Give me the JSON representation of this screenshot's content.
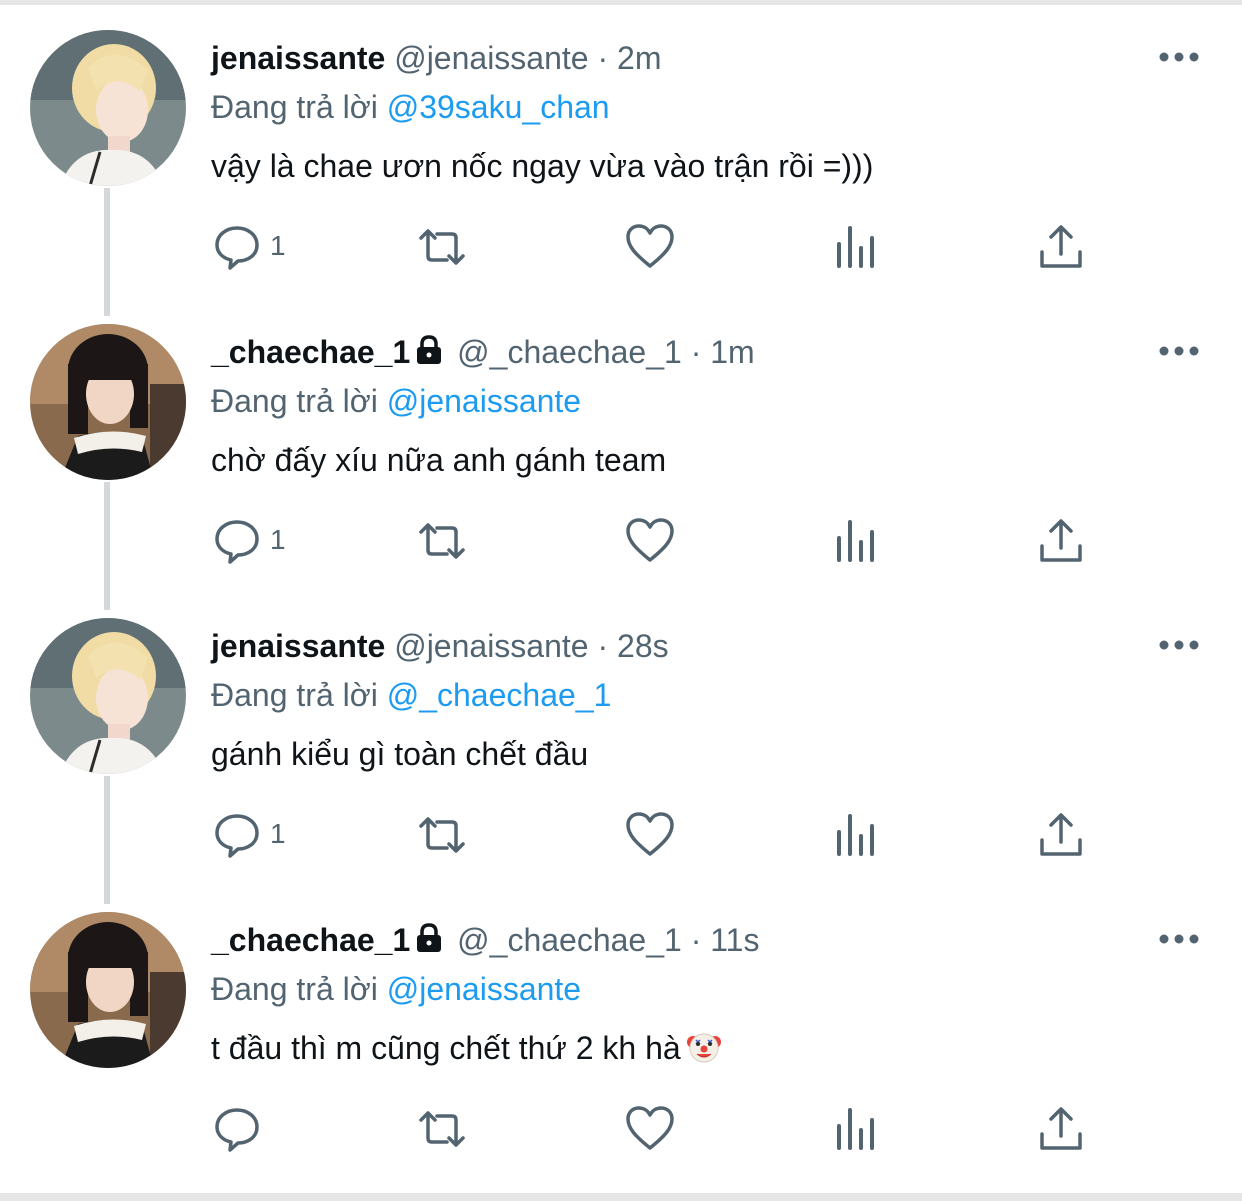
{
  "colors": {
    "text": "#0f1419",
    "secondary": "#536471",
    "accent": "#1d9bf0",
    "thread_line": "#d4d8dc"
  },
  "tweets": [
    {
      "name": "jenaissante",
      "locked": false,
      "handle": "@jenaissante",
      "sep": "·",
      "time": "2m",
      "reply_prefix": "Đang trả lời",
      "reply_to": "@39saku_chan",
      "text": "vậy là chae ươn nốc ngay vừa vào trận rồi =)))",
      "reply_count": "1",
      "avatar": "blonde-avatar"
    },
    {
      "name": "_chaechae_1",
      "locked": true,
      "handle": "@_chaechae_1",
      "sep": "·",
      "time": "1m",
      "reply_prefix": "Đang trả lời",
      "reply_to": "@jenaissante",
      "text": "chờ đấy xíu nữa anh gánh team",
      "reply_count": "1",
      "avatar": "dark-hair-avatar"
    },
    {
      "name": "jenaissante",
      "locked": false,
      "handle": "@jenaissante",
      "sep": "·",
      "time": "28s",
      "reply_prefix": "Đang trả lời",
      "reply_to": "@_chaechae_1",
      "text": "gánh kiểu gì toàn chết đầu",
      "reply_count": "1",
      "avatar": "blonde-avatar"
    },
    {
      "name": "_chaechae_1",
      "locked": true,
      "handle": "@_chaechae_1",
      "sep": "·",
      "time": "11s",
      "reply_prefix": "Đang trả lời",
      "reply_to": "@jenaissante",
      "text": "t đầu thì m cũng chết thứ 2 kh hà",
      "text_emoji": "clown-face-icon",
      "reply_count": "",
      "avatar": "dark-hair-avatar"
    }
  ]
}
